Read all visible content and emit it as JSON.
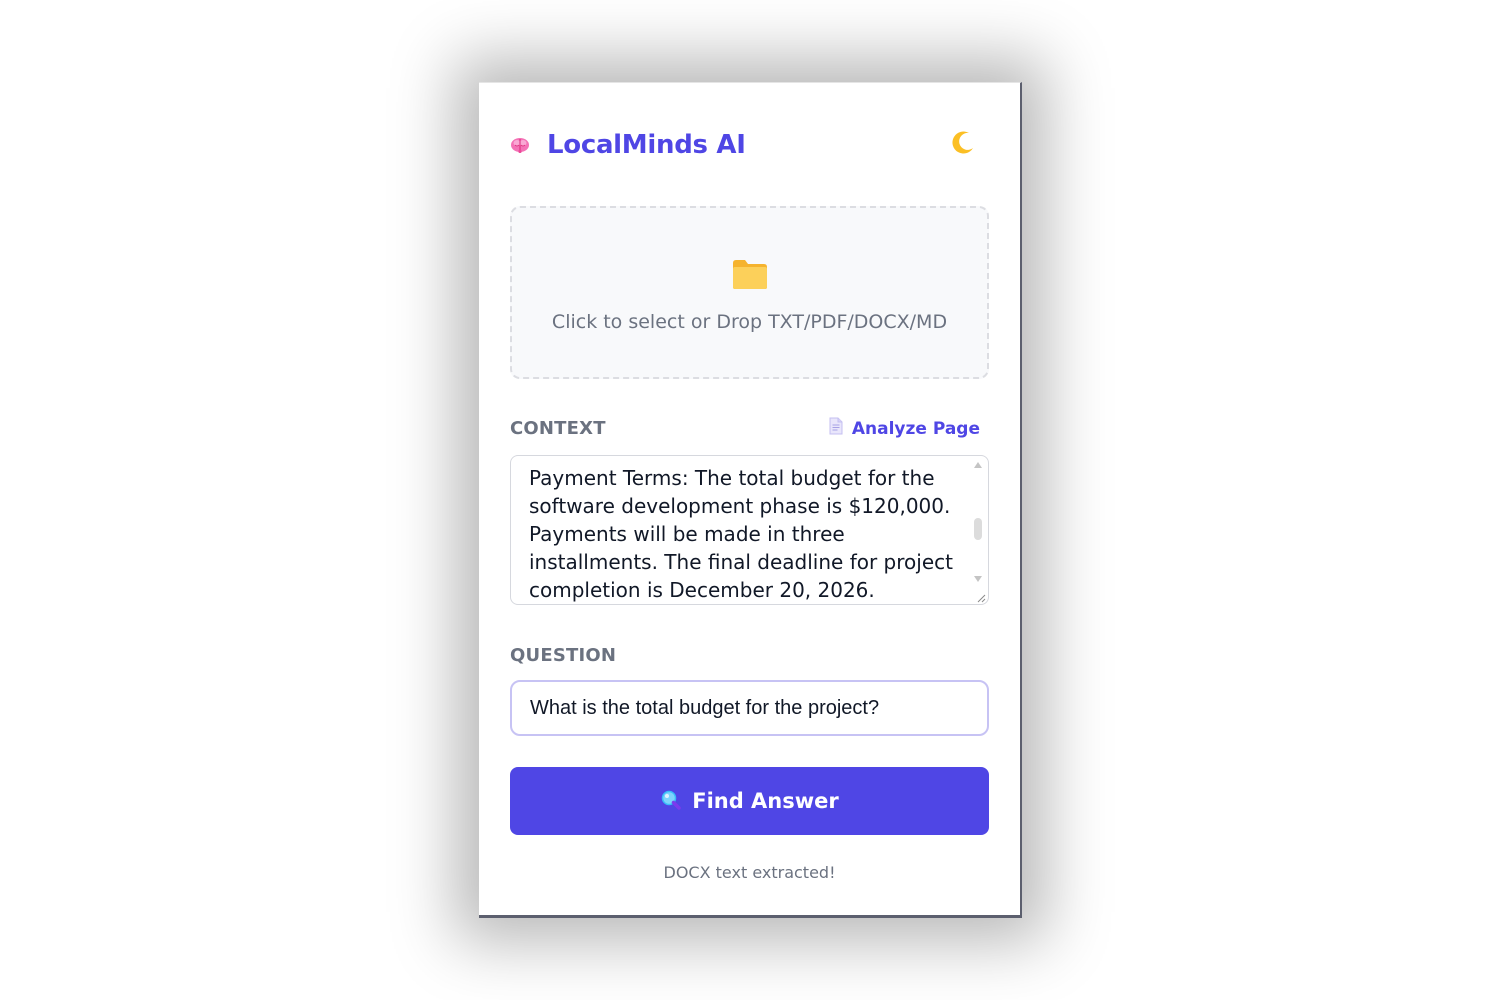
{
  "app": {
    "title": "LocalMinds AI",
    "icons": {
      "brand": "brain-icon",
      "theme_toggle": "moon-icon",
      "upload": "folder-icon",
      "analyze": "document-icon",
      "find": "magnifier-icon"
    },
    "colors": {
      "accent": "#4f46e5",
      "muted_text": "#6b7280",
      "dropzone_bg": "#f8f9fb",
      "input_border": "#c7c3f4"
    }
  },
  "dropzone": {
    "text": "Click to select or Drop TXT/PDF/DOCX/MD"
  },
  "context": {
    "label": "CONTEXT",
    "analyze_label": "Analyze Page",
    "value": "Payment Terms: The total budget for the software development phase is $120,000. Payments will be made in three installments. The final deadline for project completion is December 20, 2026."
  },
  "question": {
    "label": "QUESTION",
    "value": "What is the total budget for the project?"
  },
  "find_button": {
    "label": "Find Answer"
  },
  "status": {
    "message": "DOCX text extracted!"
  }
}
